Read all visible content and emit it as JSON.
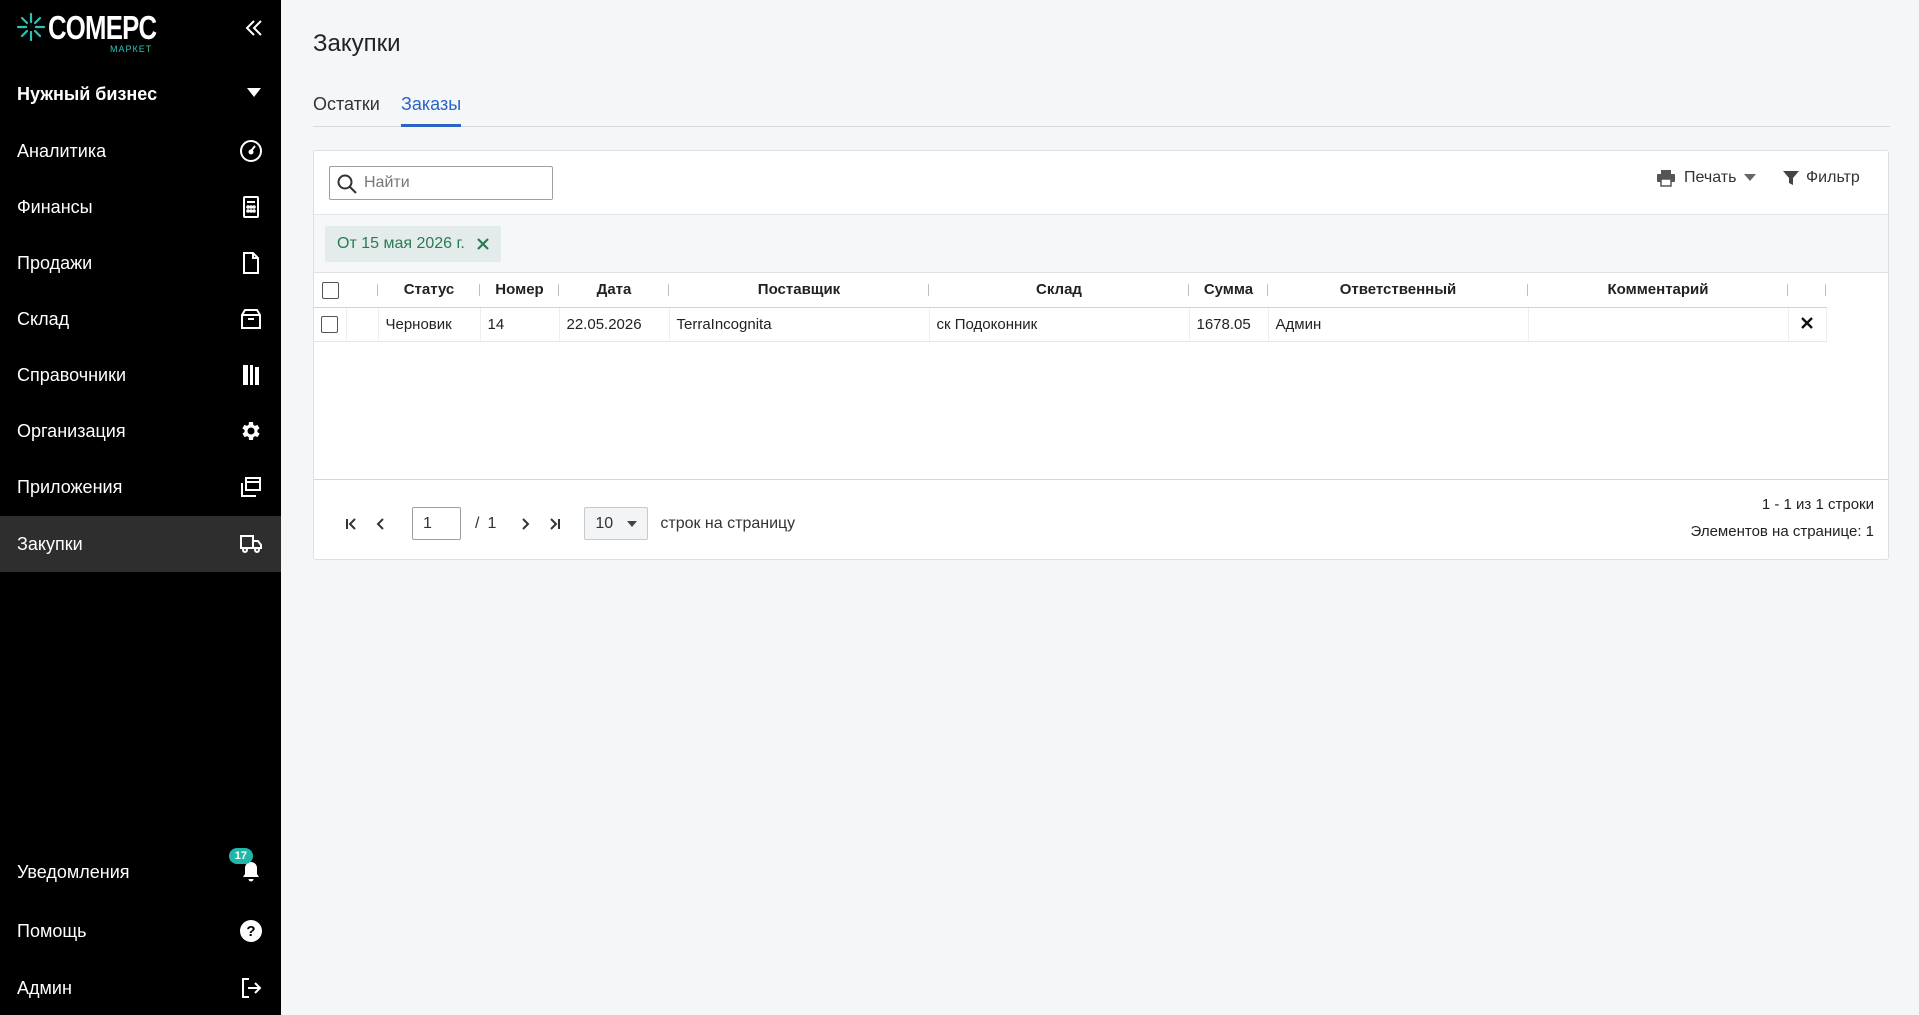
{
  "brand": {
    "name": "COMEPC",
    "sub": "МАРКЕТ",
    "accent": "#2cc3b5"
  },
  "sidebar": {
    "business": "Нужный бизнес",
    "items": [
      {
        "label": "Аналитика",
        "icon": "speedometer-icon"
      },
      {
        "label": "Финансы",
        "icon": "calculator-icon"
      },
      {
        "label": "Продажи",
        "icon": "document-icon"
      },
      {
        "label": "Склад",
        "icon": "warehouse-box-icon"
      },
      {
        "label": "Справочники",
        "icon": "books-icon"
      },
      {
        "label": "Организация",
        "icon": "gear-icon"
      },
      {
        "label": "Приложения",
        "icon": "windows-icon"
      },
      {
        "label": "Закупки",
        "icon": "truck-icon",
        "active": true
      }
    ],
    "bottom": [
      {
        "label": "Уведомления",
        "icon": "bell-icon",
        "badge": "17"
      },
      {
        "label": "Помощь",
        "icon": "help-icon"
      },
      {
        "label": "Админ",
        "icon": "logout-icon"
      }
    ]
  },
  "page": {
    "title": "Закупки"
  },
  "tabs": [
    {
      "label": "Остатки"
    },
    {
      "label": "Заказы",
      "active": true
    }
  ],
  "toolbar": {
    "search_placeholder": "Найти",
    "print_label": "Печать",
    "filter_label": "Фильтр"
  },
  "filters": {
    "chip": "От 15 мая 2026 г."
  },
  "table": {
    "columns": [
      "Статус",
      "Номер",
      "Дата",
      "Поставщик",
      "Склад",
      "Сумма",
      "Ответственный",
      "Комментарий"
    ],
    "rows": [
      {
        "status": "Черновик",
        "number": "14",
        "date": "22.05.2026",
        "supplier": "TerraIncognita",
        "warehouse": "ск Подоконник",
        "sum": "1678.05",
        "responsible": "Админ",
        "comment": ""
      }
    ]
  },
  "pagination": {
    "page": "1",
    "separator": "/",
    "total_pages": "1",
    "page_size": "10",
    "rows_label": "строк на страницу",
    "range": "1 - 1 из 1 строки",
    "per_page": "Элементов на странице: 1"
  }
}
